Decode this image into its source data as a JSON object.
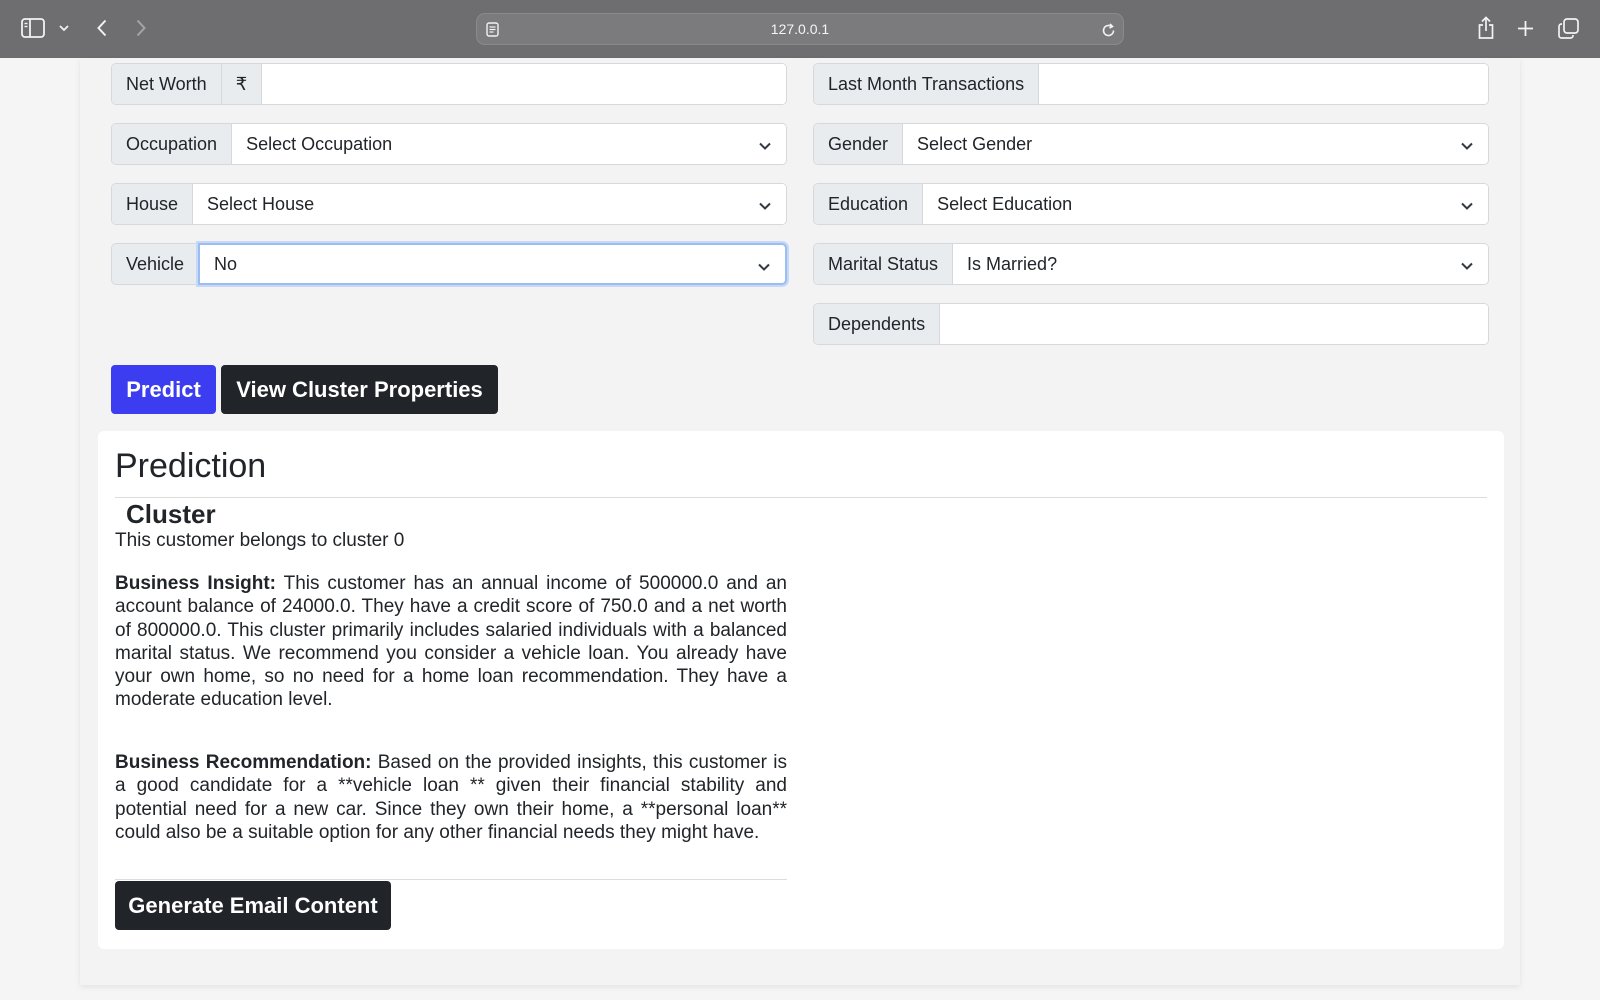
{
  "browser": {
    "url": "127.0.0.1",
    "icons": [
      "sidebar-icon",
      "chevron-down-icon",
      "back-icon",
      "forward-icon",
      "reader-icon",
      "reload-icon",
      "share-icon",
      "plus-icon",
      "tabs-icon"
    ]
  },
  "form": {
    "net_worth": {
      "label": "Net Worth",
      "addon": "₹",
      "value": ""
    },
    "last_month_transactions": {
      "label": "Last Month Transactions",
      "value": ""
    },
    "occupation": {
      "label": "Occupation",
      "selected": "Select Occupation"
    },
    "gender": {
      "label": "Gender",
      "selected": "Select Gender"
    },
    "house": {
      "label": "House",
      "selected": "Select House"
    },
    "education": {
      "label": "Education",
      "selected": "Select Education"
    },
    "vehicle": {
      "label": "Vehicle",
      "selected": "No"
    },
    "marital_status": {
      "label": "Marital Status",
      "selected": "Is Married?"
    },
    "dependents": {
      "label": "Dependents",
      "value": ""
    }
  },
  "actions": {
    "predict": "Predict",
    "view_cluster": "View Cluster Properties"
  },
  "prediction": {
    "title": "Prediction",
    "cluster_heading": "Cluster",
    "cluster_text": "This customer belongs to cluster 0",
    "insight_label": "Business Insight:",
    "insight_text": "This customer has an annual income of 500000.0 and an account balance of 24000.0. They have a credit score of 750.0 and a net worth of 800000.0. This cluster primarily includes salaried individuals with a balanced marital status. We recommend you consider a vehicle loan. You already have your own home, so no need for a home loan recommendation. They have a moderate education level.",
    "recommendation_label": "Business Recommendation:",
    "recommendation_text": "Based on the provided insights, this customer is a good candidate for a **vehicle loan ** given their financial stability and potential need for a new car. Since they own their home, a **personal loan** could also be a suitable option for any other financial needs they might have.",
    "email_button": "Generate Email Content"
  },
  "colors": {
    "primary": "#3c3cf0",
    "dark": "#212529",
    "focus_ring": "#9cbcf4"
  }
}
